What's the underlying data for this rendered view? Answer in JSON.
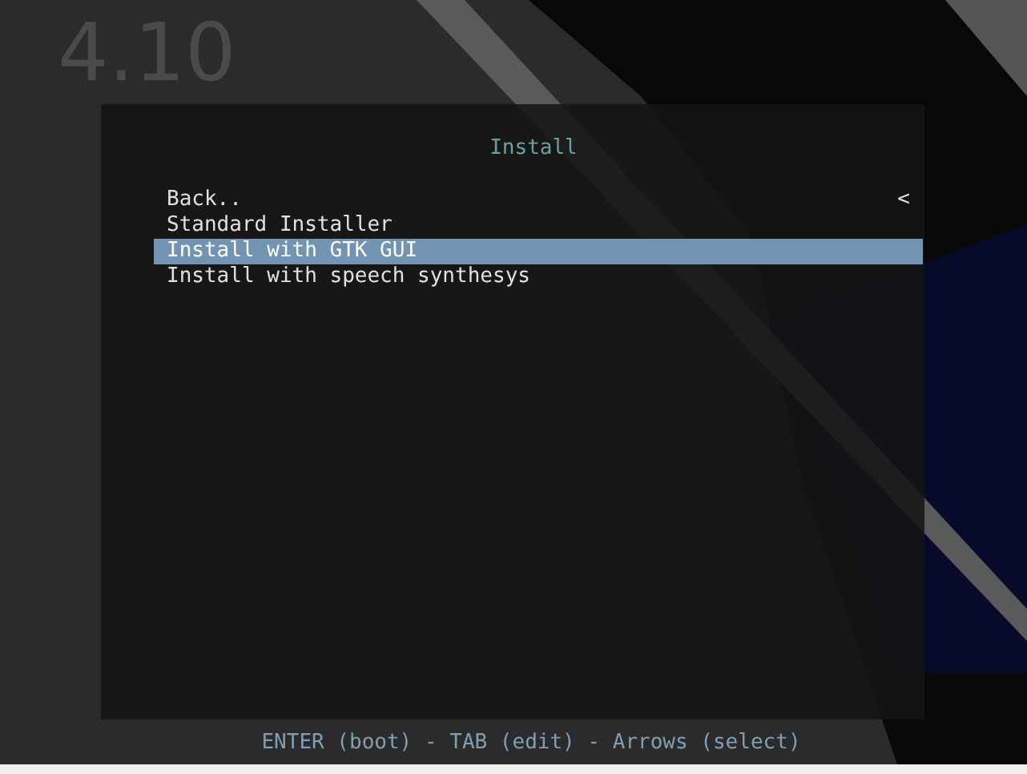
{
  "version_label": "4.10",
  "menu": {
    "title": "Install",
    "items": [
      {
        "label": "Back..",
        "kind": "back",
        "marker": "<",
        "selected": false
      },
      {
        "label": "Standard Installer",
        "kind": "entry",
        "selected": false
      },
      {
        "label": "Install with GTK GUI",
        "kind": "entry",
        "selected": true
      },
      {
        "label": "Install with speech synthesys",
        "kind": "entry",
        "selected": false
      }
    ]
  },
  "help_line": "ENTER (boot) - TAB (edit) - Arrows (select)"
}
